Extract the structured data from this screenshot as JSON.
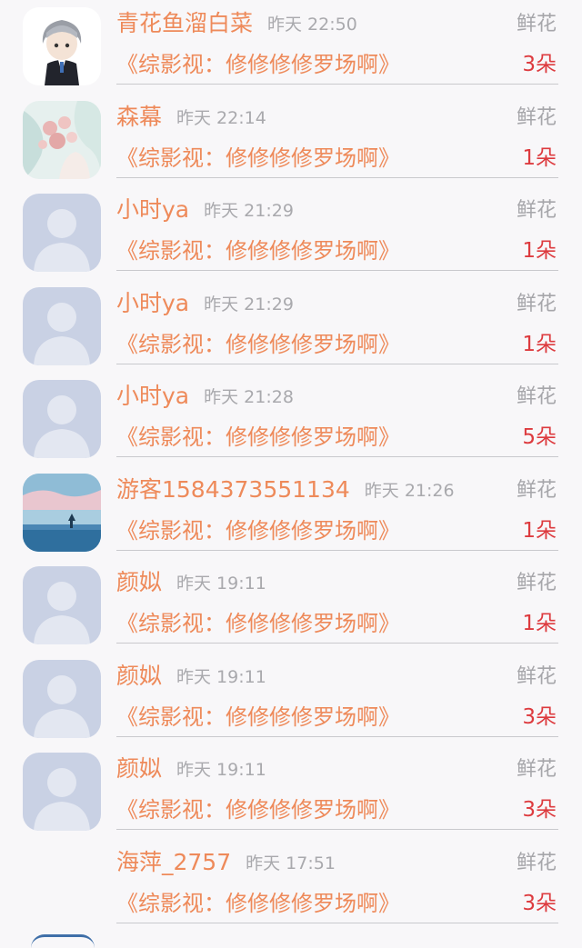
{
  "gift_label": "鲜花",
  "rows": [
    {
      "user": "青花鱼溜白菜",
      "time": "昨天 22:50",
      "book": "《综影视：修修修修罗场啊》",
      "count": "3朵",
      "avatar": "chibi"
    },
    {
      "user": "森幕",
      "time": "昨天 22:14",
      "book": "《综影视：修修修修罗场啊》",
      "count": "1朵",
      "avatar": "flowers"
    },
    {
      "user": "小时ya",
      "time": "昨天 21:29",
      "book": "《综影视：修修修修罗场啊》",
      "count": "1朵",
      "avatar": "default"
    },
    {
      "user": "小时ya",
      "time": "昨天 21:29",
      "book": "《综影视：修修修修罗场啊》",
      "count": "1朵",
      "avatar": "default"
    },
    {
      "user": "小时ya",
      "time": "昨天 21:28",
      "book": "《综影视：修修修修罗场啊》",
      "count": "5朵",
      "avatar": "default"
    },
    {
      "user": "游客1584373551134",
      "time": "昨天 21:26",
      "book": "《综影视：修修修修罗场啊》",
      "count": "1朵",
      "avatar": "sea"
    },
    {
      "user": "颜姒",
      "time": "昨天 19:11",
      "book": "《综影视：修修修修罗场啊》",
      "count": "1朵",
      "avatar": "default"
    },
    {
      "user": "颜姒",
      "time": "昨天 19:11",
      "book": "《综影视：修修修修罗场啊》",
      "count": "3朵",
      "avatar": "default"
    },
    {
      "user": "颜姒",
      "time": "昨天 19:11",
      "book": "《综影视：修修修修罗场啊》",
      "count": "3朵",
      "avatar": "default"
    },
    {
      "user": "海萍_2757",
      "time": "昨天 17:51",
      "book": "《综影视：修修修修罗场啊》",
      "count": "3朵",
      "avatar": "none"
    }
  ]
}
